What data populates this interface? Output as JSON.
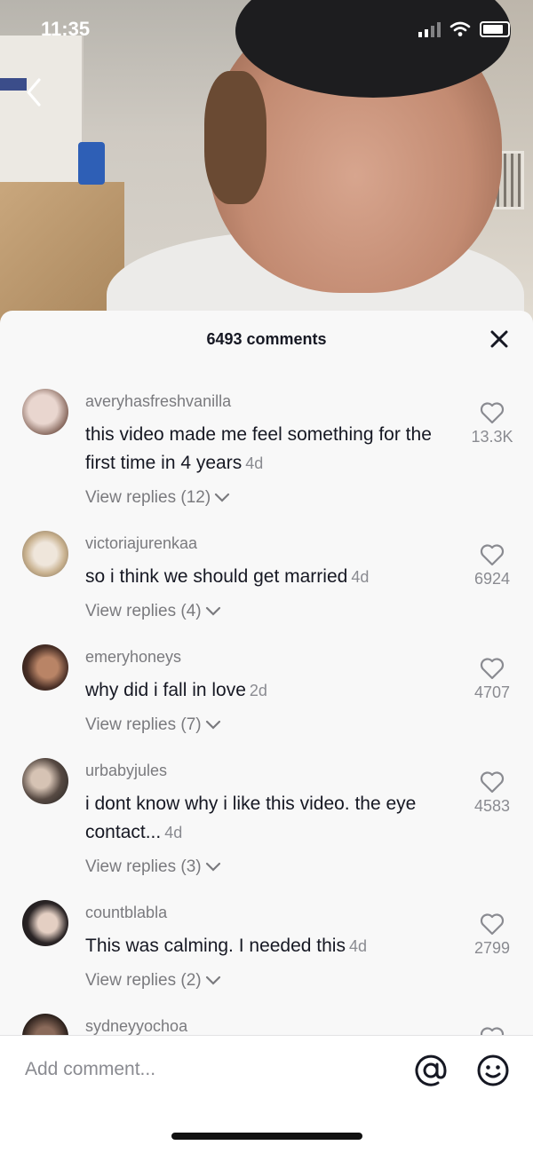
{
  "status_bar": {
    "time": "11:35"
  },
  "sheet": {
    "title": "6493 comments"
  },
  "comments": [
    {
      "username": "averyhasfreshvanilla",
      "text": "this video made me feel something for the first time in 4 years",
      "age": "4d",
      "replies": "View replies (12)",
      "likes": "13.3K"
    },
    {
      "username": "victoriajurenkaa",
      "text": "so i think we should get married",
      "age": "4d",
      "replies": "View replies (4)",
      "likes": "6924"
    },
    {
      "username": "emeryhoneys",
      "text": "why did i fall in love",
      "age": "2d",
      "replies": "View replies (7)",
      "likes": "4707"
    },
    {
      "username": "urbabyjules",
      "text": "i dont know why i like this video. the eye contact...",
      "age": "4d",
      "replies": "View replies (3)",
      "likes": "4583"
    },
    {
      "username": "countblabla",
      "text": "This was calming. I needed this",
      "age": "4d",
      "replies": "View replies (2)",
      "likes": "2799"
    },
    {
      "username": "sydneyyochoa"
    }
  ],
  "input": {
    "placeholder": "Add comment..."
  },
  "icons": {
    "back": "chevron-left-icon",
    "close": "close-icon",
    "like": "heart-outline-icon",
    "replies": "chevron-down-icon",
    "mention": "at-sign-icon",
    "emoji": "smiley-icon"
  },
  "colors": {
    "text": "#161823",
    "secondary": "#8a8b91",
    "sheet_bg": "#f8f8f8"
  }
}
